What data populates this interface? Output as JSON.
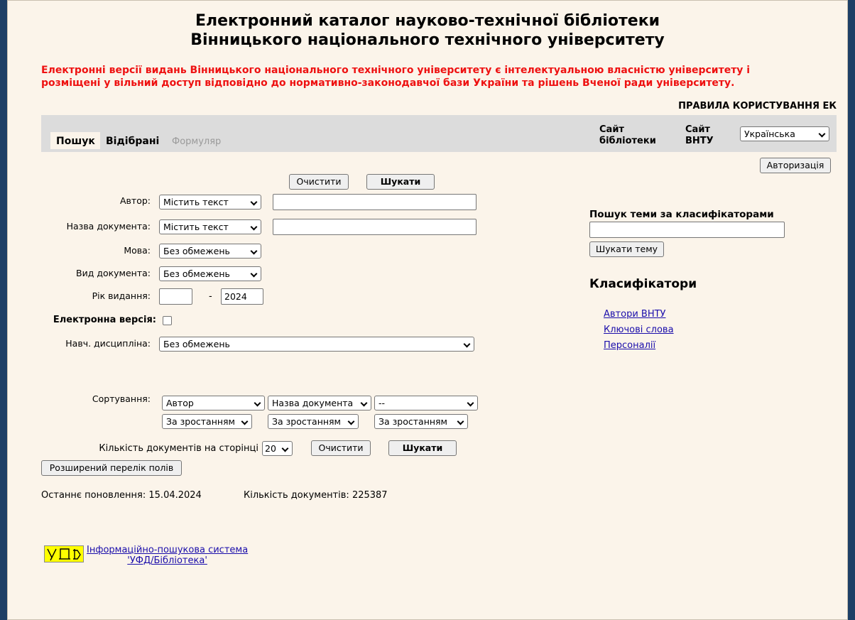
{
  "header": {
    "title_line1": "Електронний каталог науково-технічної бібліотеки",
    "title_line2": "Вінницького національного технічного університету",
    "notice_line1": "Електронні версії видань Вінницького національного технічного університету є інтелектуальною власністю університету і",
    "notice_line2": "розміщені у вільний доступ відповідно до нормативно-законодавчої бази України та рішень Вченої ради університету.",
    "rules_link": "ПРАВИЛА КОРИСТУВАННЯ ЕК"
  },
  "tabs": [
    {
      "label": "Пошук"
    },
    {
      "label": "Відібрані"
    },
    {
      "label": "Формуляр"
    }
  ],
  "site_links": {
    "library_line1": "Сайт",
    "library_line2": "бібліотеки",
    "vntu_line1": "Сайт",
    "vntu_line2": "ВНТУ"
  },
  "language_select": "Українська",
  "auth_button": "Авторизація",
  "form": {
    "clear_button": "Очистити",
    "search_button": "Шукати",
    "author_label": "Автор:",
    "author_mode": "Містить текст",
    "author_value": "",
    "docname_label": "Назва документа:",
    "docname_mode": "Містить текст",
    "docname_value": "",
    "language_label": "Мова:",
    "language_value": "Без обмежень",
    "doctype_label": "Вид документа:",
    "doctype_value": "Без обмежень",
    "year_label": "Рік видання:",
    "year_from": "",
    "year_dash": "-",
    "year_to": "2024",
    "electronic_label": "Електронна версія:",
    "discipline_label": "Навч. дисципліна:",
    "discipline_value": "Без обмежень",
    "sort_label": "Сортування:",
    "sort1_field": "Автор",
    "sort2_field": "Назва документа",
    "sort3_field": "--",
    "sort1_order": "За зростанням",
    "sort2_order": "За зростанням",
    "sort3_order": "За зростанням",
    "per_page_label": "Кількість документів на сторінці",
    "per_page_value": "20",
    "extended_button": "Розширений перелік полів"
  },
  "status": {
    "last_update": "Останнє поновлення: 15.04.2024",
    "doc_count": "Кількість документів: 225387"
  },
  "right_panel": {
    "topic_search_title": "Пошук теми за класифікаторами",
    "topic_input_value": "",
    "topic_search_button": "Шукати тему",
    "classifiers_title": "Класифікатори",
    "classifier_links": [
      "Автори ВНТУ",
      "Ключові слова",
      "Персоналії"
    ]
  },
  "footer": {
    "logo_text": "УФД",
    "system_line1": "Інформаційно-пошукова система",
    "system_line2": "'УФД/Бібліотека'"
  },
  "colors": {
    "notice": "#ee1111",
    "link": "#1a0dab",
    "background": "#fbf4ea",
    "tab_bar": "#dcdcdc",
    "logo": "#ffff00"
  }
}
